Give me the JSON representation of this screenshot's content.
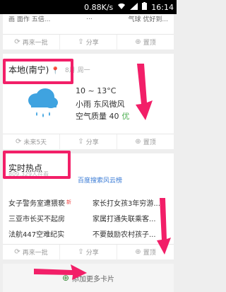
{
  "status_bar": {
    "speed": "0.88K/s",
    "wifi_icon": "wifi-icon",
    "signal_icon": "signal-icon",
    "battery_icon": "battery-icon",
    "time": "16:14"
  },
  "card_top": {
    "fragments": [
      "画 面作 五倍...",
      "...",
      "气球 优好到..."
    ],
    "actions": {
      "refresh": "再来一批",
      "share": "分享",
      "pin": "置顶"
    }
  },
  "weather": {
    "location": "本地(南宁)",
    "date": "8月 周一",
    "temp": "10 ~ 13°C",
    "desc": "小雨  东风微风",
    "aqi_label": "空气质量 40",
    "aqi_level": "优",
    "actions": {
      "next5": "未来5天",
      "share": "分享",
      "pin": "置顶"
    }
  },
  "hot": {
    "title": "实时热点",
    "tabs_text": "809,329人在看",
    "source": "百度搜索风云榜",
    "items": [
      {
        "text": "女子警务室遭猥亵",
        "new": "新"
      },
      {
        "text": "家长打女孩3年穷游..."
      },
      {
        "text": "三亚市长买不起房"
      },
      {
        "text": "家属打通失联乘客..."
      },
      {
        "text": "法航447空难纪实"
      },
      {
        "text": "不要鼓励农村孩子..."
      }
    ],
    "actions": {
      "refresh": "再来一批",
      "share": "分享",
      "pin": "置顶"
    }
  },
  "add_more": {
    "label": "添加更多卡片",
    "icon": "plus-icon"
  },
  "colors": {
    "highlight": "#f21f68",
    "good": "#4caf50",
    "link": "#3a7bd5"
  }
}
